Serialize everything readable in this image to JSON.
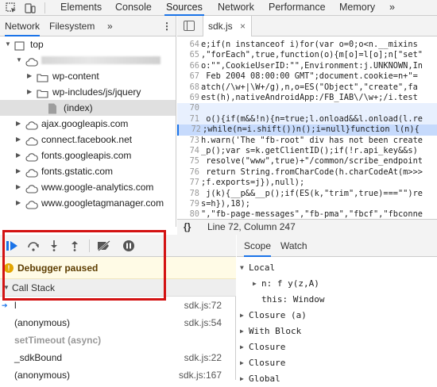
{
  "devtools": {
    "tabs": [
      "Elements",
      "Console",
      "Sources",
      "Network",
      "Performance",
      "Memory",
      "»"
    ]
  },
  "navigator": {
    "tabs": [
      "Network",
      "Filesystem",
      "»"
    ],
    "tree": [
      {
        "label": "top",
        "icon": "frame-icon",
        "expanded": true,
        "indent": 0
      },
      {
        "label": "",
        "icon": "cloud-icon",
        "expanded": true,
        "indent": 1,
        "redacted": true
      },
      {
        "label": "wp-content",
        "icon": "folder-icon",
        "expanded": false,
        "indent": 2
      },
      {
        "label": "wp-includes/js/jquery",
        "icon": "folder-icon",
        "expanded": false,
        "indent": 2
      },
      {
        "label": "(index)",
        "icon": "file-icon",
        "expanded": null,
        "indent": 3,
        "selected": true
      },
      {
        "label": "ajax.googleapis.com",
        "icon": "cloud-icon",
        "expanded": false,
        "indent": 1
      },
      {
        "label": "connect.facebook.net",
        "icon": "cloud-icon",
        "expanded": false,
        "indent": 1
      },
      {
        "label": "fonts.googleapis.com",
        "icon": "cloud-icon",
        "expanded": false,
        "indent": 1
      },
      {
        "label": "fonts.gstatic.com",
        "icon": "cloud-icon",
        "expanded": false,
        "indent": 1
      },
      {
        "label": "www.google-analytics.com",
        "icon": "cloud-icon",
        "expanded": false,
        "indent": 1
      },
      {
        "label": "www.googletagmanager.com",
        "icon": "cloud-icon",
        "expanded": false,
        "indent": 1
      }
    ]
  },
  "editor": {
    "file_tab": "sdk.js",
    "lines": [
      {
        "n": "64",
        "text": "e;if(n instanceof i)for(var o=0;o<n.__mixins"
      },
      {
        "n": "65",
        "text": ",\"forEach\",true,function(o){m[o]=l[o];n[\"set\""
      },
      {
        "n": "66",
        "text": "o:\"\",CookieUserID:\"\",Environment:j.UNKNOWN,In"
      },
      {
        "n": "67",
        "text": " Feb 2004 08:00:00 GMT\";document.cookie=n+\"="
      },
      {
        "n": "68",
        "text": "atch(/\\w+|\\W+/g),n,o=ES(\"Object\",\"create\",fa"
      },
      {
        "n": "69",
        "text": "est(h),nativeAndroidApp:/FB_IAB\\/\\w+;/i.test"
      },
      {
        "n": "70",
        "text": ""
      },
      {
        "n": "71",
        "text": " o(){if(m&&!n){n=true;l.onload&&l.onload(l.re"
      },
      {
        "n": "72",
        "text": ";while(n=i.shift())n();i=null}function l(n){"
      },
      {
        "n": "73",
        "text": "h.warn('The \"fb-root\" div has not been create"
      },
      {
        "n": "74",
        "text": "_p();var s=k.getClientID();if(!r.api_key&&s)"
      },
      {
        "n": "75",
        "text": " resolve(\"www\",true)+\"/common/scribe_endpoint"
      },
      {
        "n": "76",
        "text": " return String.fromCharCode(h.charCodeAt(m>>>"
      },
      {
        "n": "77",
        "text": ";f.exports=j}),null);"
      },
      {
        "n": "78",
        "text": " j(k){__p&&__p();if(ES(k,\"trim\",true)===\"\")re"
      },
      {
        "n": "79",
        "text": "s=h}),18);"
      },
      {
        "n": "80",
        "text": "\",\"fb-page-messages\",\"fb-pma\",\"fbcf\",\"fbconne"
      }
    ],
    "status": "Line 72, Column 247",
    "status_icon": "{}"
  },
  "debugger": {
    "paused": "Debugger paused",
    "call_stack_label": "Call Stack",
    "frames": [
      {
        "name": "l",
        "loc": "sdk.js:72",
        "current": true
      },
      {
        "name": "(anonymous)",
        "loc": "sdk.js:54"
      },
      {
        "name": "setTimeout (async)",
        "loc": "",
        "async": true
      },
      {
        "name": "_sdkBound",
        "loc": "sdk.js:22"
      },
      {
        "name": "(anonymous)",
        "loc": "sdk.js:167"
      }
    ]
  },
  "scope": {
    "tabs": [
      "Scope",
      "Watch"
    ],
    "items": [
      {
        "text": "Local",
        "expanded": true,
        "indent": 0
      },
      {
        "text": "n: f y(z,A)",
        "expanded": false,
        "indent": 1
      },
      {
        "text": "this: Window",
        "expanded": null,
        "indent": 1
      },
      {
        "text": "Closure (a)",
        "expanded": false,
        "indent": 0
      },
      {
        "text": "With Block",
        "expanded": false,
        "indent": 0
      },
      {
        "text": "Closure",
        "expanded": false,
        "indent": 0
      },
      {
        "text": "Closure",
        "expanded": false,
        "indent": 0
      },
      {
        "text": "Global",
        "expanded": false,
        "indent": 0
      }
    ]
  },
  "colors": {
    "accent": "#1a73e8",
    "highlight": "#d31212"
  }
}
